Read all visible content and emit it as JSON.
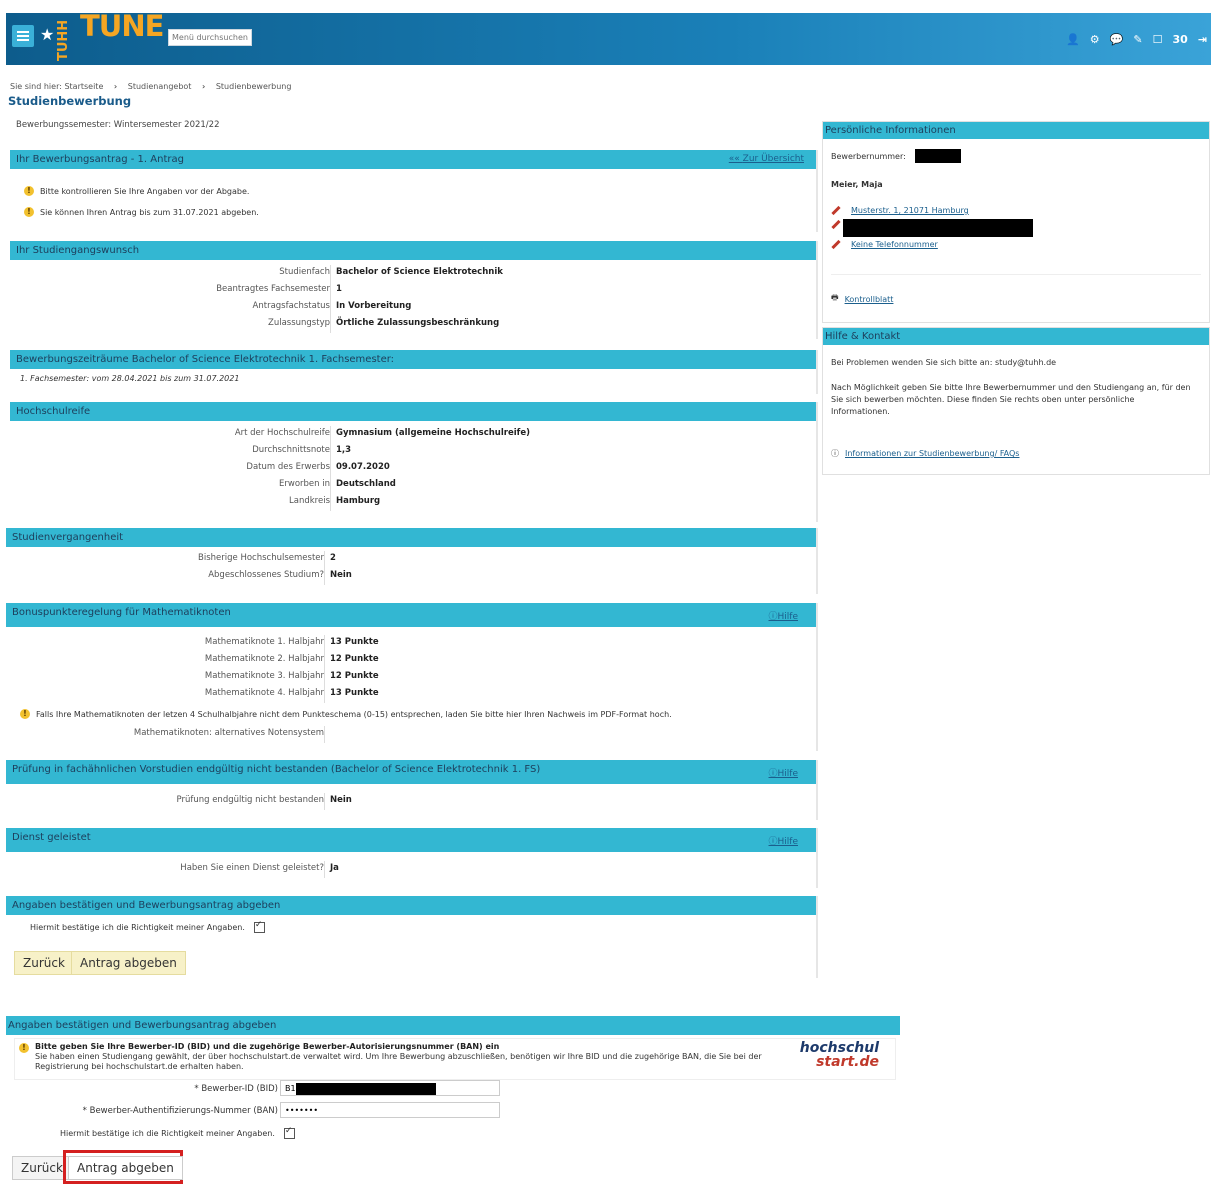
{
  "header": {
    "logo_vertical": "TUHH",
    "logo": "TUNE",
    "search_placeholder": "Menü durchsuchen",
    "counter": "30"
  },
  "breadcrumb": {
    "prefix": "Sie sind hier:",
    "items": [
      "Startseite",
      "Studienangebot",
      "Studienbewerbung"
    ]
  },
  "page_title": "Studienbewerbung",
  "semester": "Bewerbungssemester: Wintersemester 2021/22",
  "antrag": {
    "title": "Ihr Bewerbungsantrag - 1. Antrag",
    "overview_link": "Zur Übersicht",
    "msg1": "Bitte kontrollieren Sie Ihre Angaben vor der Abgabe.",
    "msg2": "Sie können Ihren Antrag bis zum 31.07.2021 abgeben."
  },
  "wunsch": {
    "title": "Ihr Studiengangswunsch",
    "rows": [
      {
        "label": "Studienfach",
        "value": "Bachelor of Science Elektrotechnik"
      },
      {
        "label": "Beantragtes Fachsemester",
        "value": "1"
      },
      {
        "label": "Antragsfachstatus",
        "value": "In Vorbereitung"
      },
      {
        "label": "Zulassungstyp",
        "value": "Örtliche Zulassungsbeschränkung"
      }
    ]
  },
  "zeitraeume": {
    "title": "Bewerbungszeiträume Bachelor of Science Elektrotechnik 1. Fachsemester:",
    "text": "1. Fachsemester: vom 28.04.2021 bis zum 31.07.2021"
  },
  "hochschulreife": {
    "title": "Hochschulreife",
    "rows": [
      {
        "label": "Art der Hochschulreife",
        "value": "Gymnasium (allgemeine Hochschulreife)"
      },
      {
        "label": "Durchschnittsnote",
        "value": "1,3"
      },
      {
        "label": "Datum des Erwerbs",
        "value": "09.07.2020"
      },
      {
        "label": "Erworben in",
        "value": "Deutschland"
      },
      {
        "label": "Landkreis",
        "value": "Hamburg"
      }
    ]
  },
  "vergangenheit": {
    "title": "Studienvergangenheit",
    "rows": [
      {
        "label": "Bisherige Hochschulsemester",
        "value": "2"
      },
      {
        "label": "Abgeschlossenes Studium?",
        "value": "Nein"
      }
    ]
  },
  "bonus": {
    "title": "Bonuspunkteregelung für Mathematiknoten",
    "hilfe": "Hilfe",
    "rows": [
      {
        "label": "Mathematiknote 1. Halbjahr",
        "value": "13 Punkte"
      },
      {
        "label": "Mathematiknote 2. Halbjahr",
        "value": "12 Punkte"
      },
      {
        "label": "Mathematiknote 3. Halbjahr",
        "value": "12 Punkte"
      },
      {
        "label": "Mathematiknote 4. Halbjahr",
        "value": "13 Punkte"
      }
    ],
    "note": "Falls Ihre Mathematiknoten der letzen 4 Schulhalbjahre nicht dem Punkteschema (0-15) entsprechen, laden Sie bitte hier Ihren Nachweis im PDF-Format hoch.",
    "alt_label": "Mathematiknoten: alternatives Notensystem"
  },
  "pruefung": {
    "title": "Prüfung in fachähnlichen Vorstudien endgültig nicht bestanden (Bachelor of Science Elektrotechnik 1. FS)",
    "hilfe": "Hilfe",
    "label": "Prüfung endgültig nicht bestanden",
    "value": "Nein"
  },
  "dienst": {
    "title": "Dienst geleistet",
    "hilfe": "Hilfe",
    "label": "Haben Sie einen Dienst geleistet?",
    "value": "Ja"
  },
  "confirm": {
    "title": "Angaben bestätigen und Bewerbungsantrag abgeben",
    "checkbox_label": "Hiermit bestätige ich die Richtigkeit meiner Angaben.",
    "back": "Zurück",
    "submit": "Antrag abgeben"
  },
  "right": {
    "personal_title": "Persönliche Informationen",
    "bewerber_label": "Bewerbernummer:",
    "name": "Meier, Maja",
    "address": "Musterstr. 1, 21071 Hamburg",
    "phone": "Keine Telefonnummer",
    "kontrollblatt": "Kontrollblatt",
    "hilfe_title": "Hilfe & Kontakt",
    "hilfe_text1": "Bei Problemen wenden Sie sich bitte an: study@tuhh.de",
    "hilfe_text2": "Nach Möglichkeit geben Sie bitte Ihre Bewerbernummer und den Studiengang an, für den Sie sich bewerben möchten. Diese finden Sie rechts oben unter persönliche Informationen.",
    "faq_link": "Informationen zur Studienbewerbung/ FAQs"
  },
  "bottom": {
    "title": "Angaben bestätigen und Bewerbungsantrag abgeben",
    "msg_bold": "Bitte geben Sie Ihre Bewerber-ID (BID) und die zugehörige Bewerber-Autorisierungsnummer (BAN) ein",
    "msg_text": "Sie haben einen Studiengang gewählt, der über hochschulstart.de verwaltet wird. Um Ihre Bewerbung abzuschließen, benötigen wir Ihre BID und die zugehörige BAN, die Sie bei der Registrierung bei hochschulstart.de erhalten haben.",
    "bid_label": "* Bewerber-ID (BID)",
    "bid_value": "B18",
    "ban_label": "* Bewerber-Authentifizierungs-Nummer (BAN)",
    "ban_value": "•••••••",
    "checkbox_label": "Hiermit bestätige ich die Richtigkeit meiner Angaben.",
    "back": "Zurück",
    "submit": "Antrag abgeben",
    "logo_line1": "hochschul",
    "logo_line2": "start.de"
  },
  "colors": {
    "header": "#1a80b8",
    "panel_head": "#33b7d2",
    "logo": "#f5a623",
    "highlight": "#d42020"
  }
}
